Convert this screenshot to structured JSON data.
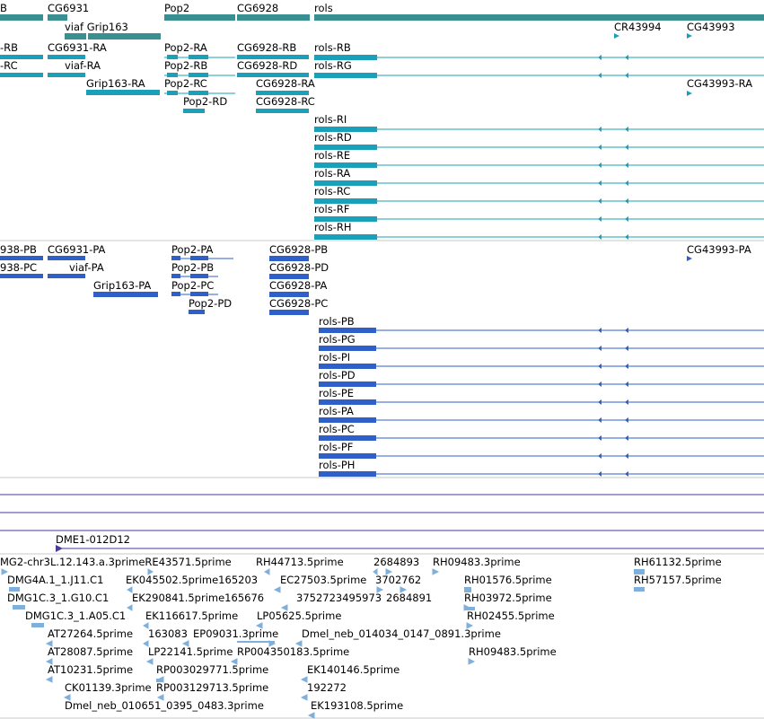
{
  "colors": {
    "gene": "#3a9090",
    "transcript_rna": "#1aa0b8",
    "transcript_protein": "#2f5fc8",
    "match": "#4a3a9a",
    "est": "#7fb0dc",
    "separator": "#c8c8c8"
  },
  "genes": [
    {
      "label": "CG6931"
    },
    {
      "label": "viaf Grip163"
    },
    {
      "label": "Pop2"
    },
    {
      "label": "CG6928"
    },
    {
      "label": "rols"
    },
    {
      "label": "CR43994"
    },
    {
      "label": "CG43993"
    }
  ],
  "rna_transcripts": [
    "CG6931-RA",
    "viaf-RA",
    "Grip163-RA",
    "Pop2-RA",
    "Pop2-RB",
    "Pop2-RC",
    "Pop2-RD",
    "CG6928-RB",
    "CG6928-RD",
    "CG6928-RA",
    "CG6928-RC",
    "rols-RB",
    "rols-RG",
    "rols-RI",
    "rols-RD",
    "rols-RE",
    "rols-RA",
    "rols-RC",
    "rols-RF",
    "rols-RH",
    "CG43993-RA"
  ],
  "protein_transcripts": [
    "CG6931-PA",
    "viaf-PA",
    "Grip163-PA",
    "Pop2-PA",
    "Pop2-PB",
    "Pop2-PC",
    "Pop2-PD",
    "CG6928-PB",
    "CG6928-PD",
    "CG6928-PA",
    "CG6928-PC",
    "rols-PB",
    "rols-PG",
    "rols-PI",
    "rols-PD",
    "rols-PE",
    "rols-PA",
    "rols-PC",
    "rols-PF",
    "rols-PH",
    "CG43993-PA"
  ],
  "clipped_labels": [
    "B",
    "-RB",
    "-RC",
    "938-PB",
    "938-PC"
  ],
  "match_feature": "DME1-012D12",
  "est_labels": [
    "MG2-chr3L.12.143.a.3primeRE43571.5prime",
    "RH44713.5prime",
    "2684893",
    "RH09483.3prime",
    "RH61132.5prime",
    "DMG4A.1_1.J11.C1",
    "EK045502.5prime165203",
    "EC27503.5prime",
    "3702762",
    "RH01576.5prime",
    "RH57157.5prime",
    "DMG1C.3_1.G10.C1",
    "EK290841.5prime165676",
    "3752723495973",
    "2684891",
    "RH03972.5prime",
    "DMG1C.3_1.A05.C1",
    "EK116617.5prime",
    "LP05625.5prime",
    "RH02455.5prime",
    "AT27264.5prime",
    "163083",
    "EP09031.3prime",
    "Dmel_neb_014034_0147_0891.3prime",
    "AT28087.5prime",
    "LP22141.5prime",
    "RP004350183.5prime",
    "RH09483.5prime",
    "AT10231.5prime",
    "RP003029771.5prime",
    "EK140146.5prime",
    "CK01139.3prime",
    "RP003129713.5prime",
    "192272",
    "Dmel_neb_010651_0395_0483.3prime",
    "EK193108.5prime"
  ]
}
